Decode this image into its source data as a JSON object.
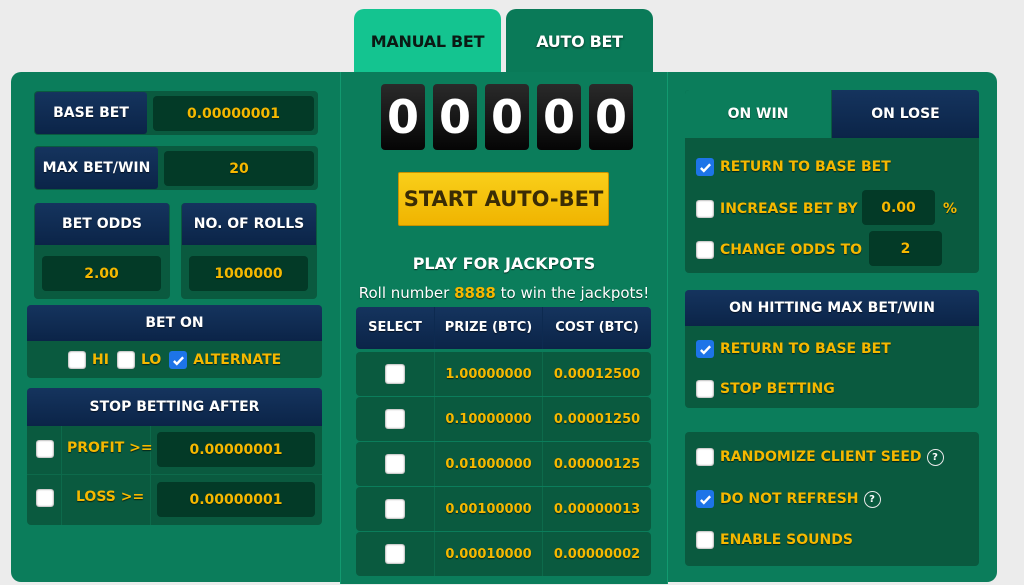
{
  "tabs": {
    "manual": "MANUAL BET",
    "auto": "AUTO BET",
    "active": "auto"
  },
  "left": {
    "base_bet": {
      "label": "BASE BET",
      "value": "0.00000001"
    },
    "max_bet_win": {
      "label": "MAX BET/WIN",
      "value": "20"
    },
    "bet_odds": {
      "label": "BET ODDS",
      "value": "2.00"
    },
    "num_rolls": {
      "label": "NO. OF ROLLS",
      "value": "1000000"
    },
    "bet_on": {
      "title": "BET ON",
      "options": [
        {
          "label": "HI",
          "checked": false
        },
        {
          "label": "LO",
          "checked": false
        },
        {
          "label": "ALTERNATE",
          "checked": true
        }
      ]
    },
    "stop_after": {
      "title": "STOP BETTING AFTER",
      "rows": [
        {
          "label": "PROFIT >=",
          "value": "0.00000001",
          "checked": false
        },
        {
          "label": "LOSS >=",
          "value": "0.00000001",
          "checked": false
        }
      ]
    }
  },
  "middle": {
    "counter": [
      "0",
      "0",
      "0",
      "0",
      "0"
    ],
    "start_button": "START AUTO-BET",
    "jackpot_title": "PLAY FOR JACKPOTS",
    "jackpot_text_before": "Roll number ",
    "jackpot_number": "8888",
    "jackpot_text_after": " to win the jackpots!",
    "table": {
      "headers": [
        "SELECT",
        "PRIZE (BTC)",
        "COST (BTC)"
      ],
      "rows": [
        {
          "prize": "1.00000000",
          "cost": "0.00012500",
          "checked": false
        },
        {
          "prize": "0.10000000",
          "cost": "0.00001250",
          "checked": false
        },
        {
          "prize": "0.01000000",
          "cost": "0.00000125",
          "checked": false
        },
        {
          "prize": "0.00100000",
          "cost": "0.00000013",
          "checked": false
        },
        {
          "prize": "0.00010000",
          "cost": "0.00000002",
          "checked": false
        }
      ]
    }
  },
  "right": {
    "win_lose_tabs": {
      "win": "ON WIN",
      "lose": "ON LOSE",
      "active": "win"
    },
    "on_win": {
      "return_base": {
        "label": "RETURN TO BASE BET",
        "checked": true
      },
      "increase_by": {
        "label": "INCREASE BET BY",
        "value": "0.00",
        "unit": "%",
        "checked": false
      },
      "change_odds": {
        "label": "CHANGE ODDS TO",
        "value": "2",
        "checked": false
      }
    },
    "max_hit": {
      "title": "ON HITTING MAX BET/WIN",
      "return_base": {
        "label": "RETURN TO BASE BET",
        "checked": true
      },
      "stop_betting": {
        "label": "STOP BETTING",
        "checked": false
      }
    },
    "options": {
      "randomize_seed": {
        "label": "RANDOMIZE CLIENT SEED",
        "checked": false,
        "help": "?"
      },
      "do_not_refresh": {
        "label": "DO NOT REFRESH",
        "checked": true,
        "help": "?"
      },
      "enable_sounds": {
        "label": "ENABLE SOUNDS",
        "checked": false
      }
    }
  }
}
